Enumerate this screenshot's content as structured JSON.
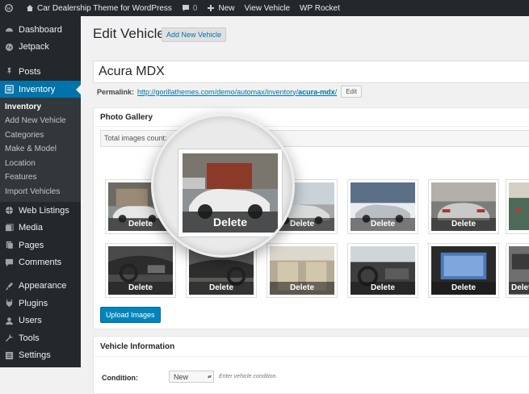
{
  "adminbar": {
    "site_name": "Car Dealership Theme for WordPress",
    "comments_count": "0",
    "new_label": "New",
    "view_vehicle": "View Vehicle",
    "wp_rocket": "WP Rocket"
  },
  "sidebar": {
    "items": [
      {
        "label": "Dashboard",
        "icon": "dashboard-icon"
      },
      {
        "label": "Jetpack",
        "icon": "jetpack-icon"
      },
      {
        "label": "Posts",
        "icon": "pin-icon"
      },
      {
        "label": "Inventory",
        "icon": "inventory-icon"
      },
      {
        "label": "Web Listings",
        "icon": "globe-icon"
      },
      {
        "label": "Media",
        "icon": "media-icon"
      },
      {
        "label": "Pages",
        "icon": "pages-icon"
      },
      {
        "label": "Comments",
        "icon": "comments-icon"
      },
      {
        "label": "Appearance",
        "icon": "brush-icon"
      },
      {
        "label": "Plugins",
        "icon": "plug-icon"
      },
      {
        "label": "Users",
        "icon": "users-icon"
      },
      {
        "label": "Tools",
        "icon": "wrench-icon"
      },
      {
        "label": "Settings",
        "icon": "settings-icon"
      }
    ],
    "submenu": [
      "Inventory",
      "Add New Vehicle",
      "Categories",
      "Make & Model",
      "Location",
      "Features",
      "Import Vehicles"
    ]
  },
  "page": {
    "title": "Edit Vehicle",
    "add_new": "Add New Vehicle",
    "vehicle_title": "Acura MDX",
    "permalink_label": "Permalink:",
    "permalink_base": "http://gorillathemes.com/demo/automax/inventory/",
    "permalink_slug": "acura-mdx",
    "permalink_end": "/",
    "edit_label": "Edit"
  },
  "gallery": {
    "title": "Photo Gallery",
    "total_label": "Total images count:",
    "delete_label": "Delete",
    "magnified_delete": "Delete",
    "upload_label": "Upload Images"
  },
  "vehicle_info": {
    "title": "Vehicle Information",
    "condition_label": "Condition:",
    "condition_value": "New",
    "condition_hint": "Enter vehicle condition."
  },
  "colors": {
    "adminbar": "#23282d",
    "active_menu": "#0073aa",
    "primary_button": "#0085ba"
  }
}
